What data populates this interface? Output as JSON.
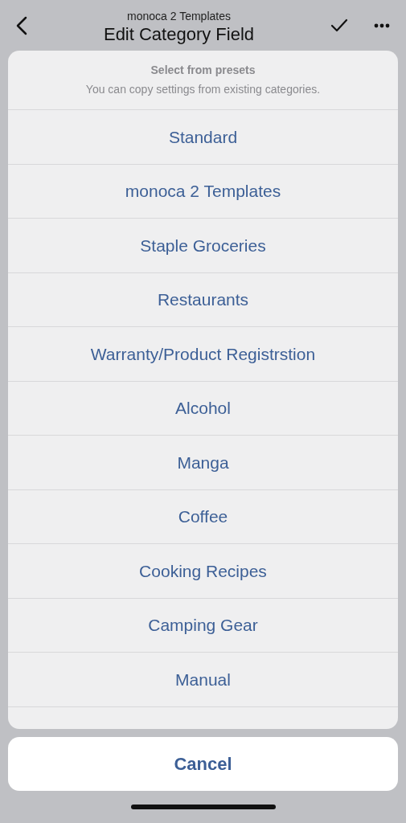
{
  "nav": {
    "subtitle": "monoca 2 Templates",
    "title": "Edit Category Field"
  },
  "sheet": {
    "title": "Select from presets",
    "message": "You can copy settings from existing categories.",
    "options": [
      "Standard",
      "monoca 2 Templates",
      "Staple Groceries",
      "Restaurants",
      "Warranty/Product Registrstion",
      "Alcohol",
      "Manga",
      "Coffee",
      "Cooking Recipes",
      "Camping Gear",
      "Manual"
    ]
  },
  "cancel": "Cancel"
}
